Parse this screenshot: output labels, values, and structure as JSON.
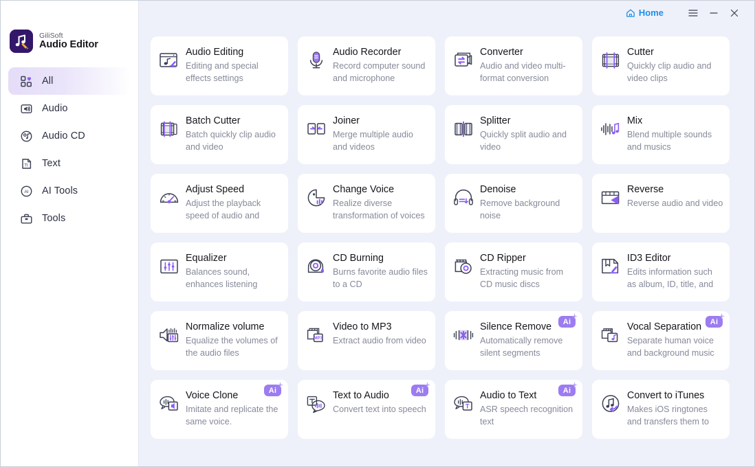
{
  "window": {
    "home_label": "Home",
    "menu_icon": "hamburger-menu-icon",
    "minimize_icon": "minimize-icon",
    "close_icon": "close-icon",
    "accent_blue": "#1e8fe8",
    "accent_purple": "#8b5cf6",
    "background": "#eef1fa"
  },
  "brand": {
    "company": "GiliSoft",
    "product": "Audio Editor",
    "logo_icon": "music-note-pencil-logo-icon"
  },
  "sidebar": {
    "items": [
      {
        "label": "All",
        "icon": "grid-heart-icon",
        "active": true
      },
      {
        "label": "Audio",
        "icon": "speaker-icon",
        "active": false
      },
      {
        "label": "Audio CD",
        "icon": "audio-cd-icon",
        "active": false
      },
      {
        "label": "Text",
        "icon": "text-file-icon",
        "active": false
      },
      {
        "label": "AI Tools",
        "icon": "ai-circle-icon",
        "active": false
      },
      {
        "label": "Tools",
        "icon": "toolbox-icon",
        "active": false
      }
    ]
  },
  "main": {
    "cards": [
      {
        "title": "Audio Editing",
        "desc": "Editing and special effects settings",
        "icon": "window-music-pencil-icon",
        "ai": false
      },
      {
        "title": "Audio Recorder",
        "desc": "Record computer sound and microphone",
        "icon": "microphone-icon",
        "ai": false
      },
      {
        "title": "Converter",
        "desc": "Audio and video multi-format conversion",
        "icon": "convert-arrows-icon",
        "ai": false
      },
      {
        "title": "Cutter",
        "desc": "Quickly clip audio and video clips",
        "icon": "film-cut-icon",
        "ai": false
      },
      {
        "title": "Batch Cutter",
        "desc": "Batch quickly clip audio and video",
        "icon": "batch-film-cut-icon",
        "ai": false
      },
      {
        "title": "Joiner",
        "desc": "Merge multiple audio and videos",
        "icon": "join-arrows-icon",
        "ai": false
      },
      {
        "title": "Splitter",
        "desc": "Quickly split audio and video",
        "icon": "split-panels-icon",
        "ai": false
      },
      {
        "title": "Mix",
        "desc": "Blend multiple sounds and musics",
        "icon": "waveform-note-icon",
        "ai": false
      },
      {
        "title": "Adjust Speed",
        "desc": "Adjust the playback speed of audio and",
        "icon": "speedometer-icon",
        "ai": false
      },
      {
        "title": "Change Voice",
        "desc": "Realize diverse transformation of voices",
        "icon": "voice-change-icon",
        "ai": false
      },
      {
        "title": "Denoise",
        "desc": "Remove background noise",
        "icon": "headphone-denoise-icon",
        "ai": false
      },
      {
        "title": "Reverse",
        "desc": "Reverse audio and video",
        "icon": "reverse-play-icon",
        "ai": false
      },
      {
        "title": "Equalizer",
        "desc": "Balances sound, enhances listening",
        "icon": "equalizer-sliders-icon",
        "ai": false
      },
      {
        "title": "CD Burning",
        "desc": "Burns favorite audio files to a CD",
        "icon": "cd-burn-icon",
        "ai": false
      },
      {
        "title": "CD Ripper",
        "desc": "Extracting music from CD music discs",
        "icon": "cd-rip-icon",
        "ai": false
      },
      {
        "title": "ID3 Editor",
        "desc": "Edits information such as album, ID, title, and cover",
        "icon": "tag-edit-icon",
        "ai": false
      },
      {
        "title": "Normalize volume",
        "desc": "Equalize the volumes of the audio files",
        "icon": "volume-normalize-icon",
        "ai": false
      },
      {
        "title": "Video to MP3",
        "desc": "Extract audio from video",
        "icon": "video-mp3-icon",
        "ai": false
      },
      {
        "title": "Silence Remove",
        "desc": "Automatically remove silent segments",
        "icon": "silence-remove-icon",
        "ai": true
      },
      {
        "title": "Vocal Separation",
        "desc": "Separate human voice and background music",
        "icon": "vocal-separation-icon",
        "ai": true
      },
      {
        "title": "Voice Clone",
        "desc": "Imitate and replicate the same voice.",
        "icon": "voice-clone-icon",
        "ai": true
      },
      {
        "title": "Text to Audio",
        "desc": "Convert text into speech",
        "icon": "text-to-audio-icon",
        "ai": true
      },
      {
        "title": "Audio to Text",
        "desc": "ASR speech recognition text",
        "icon": "audio-to-text-icon",
        "ai": true
      },
      {
        "title": "Convert to iTunes",
        "desc": "Makes iOS ringtones and transfers them to iTunes",
        "icon": "itunes-convert-icon",
        "ai": false
      }
    ],
    "ai_badge_label": "Ai"
  }
}
